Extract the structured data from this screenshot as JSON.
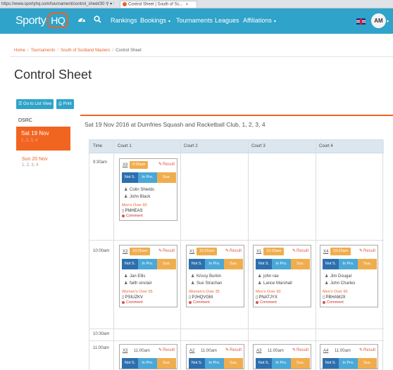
{
  "browser": {
    "url": "https://www.sportyhq.com/tournament/control_sheet/30",
    "url_icons": "⚲ ▾ ↻",
    "tab_title": "Control Sheet | South of Sc...",
    "tab_close": "×"
  },
  "navbar": {
    "logo_text": "Sporty",
    "logo_badge": "HQ",
    "items": [
      {
        "label": "Rankings"
      },
      {
        "label": "Bookings",
        "caret": "▾"
      },
      {
        "label": "Tournaments"
      },
      {
        "label": "Leagues"
      },
      {
        "label": "Affiliations",
        "caret": "▾"
      }
    ],
    "avatar_initials": "AM",
    "avatar_caret": "▾"
  },
  "breadcrumb": {
    "items": [
      "Home",
      "Tournaments",
      "South of Scotland Masters"
    ],
    "current": "Control Sheet",
    "separator": "/"
  },
  "page_title": "Control Sheet",
  "buttons": {
    "list_view": "☰ Go to List View",
    "print": "⎙ Print"
  },
  "sidebar": {
    "venue_code": "DSRC",
    "days": [
      {
        "label": "Sat 19 Nov",
        "courts": "1, 2, 3, 4"
      },
      {
        "label": "Sun 20 Nov",
        "courts": "1, 2, 3, 4"
      }
    ]
  },
  "schedule": {
    "header": "Sat 19 Nov 2016 at Dumfries Squash and Racketball Club, 1, 2, 3, 4",
    "columns": [
      "Time",
      "Court 1",
      "Court 2",
      "Court 3",
      "Court 4"
    ],
    "times": [
      "9:30am",
      "10:00am",
      "10:30am",
      "11:00am"
    ],
    "status_labels": {
      "not_started": "Not S.",
      "in_progress": "In Pro.",
      "suspended": "Sus."
    },
    "result_label": "Result",
    "comment_label": "Comment",
    "matches": [
      {
        "num": "X9",
        "time": "9:55am",
        "players": [
          "Colin Shields",
          "John Black"
        ],
        "category": "Men's Over 60",
        "code": "PMHEAS"
      },
      {
        "num": "X3",
        "time": "10:25am",
        "players": [
          "Jan Ellis",
          "faith sinclair"
        ],
        "category": "Women's Over 55",
        "code": "PSIUZKV"
      },
      {
        "num": "X1",
        "time": "10:25am",
        "players": [
          "Krissy Burkin",
          "Sue Strachan"
        ],
        "category": "Women's Over 35",
        "code": "PJHQVGM"
      },
      {
        "num": "X1",
        "time": "10:25am",
        "players": [
          "john rae",
          "Lance Marshall"
        ],
        "category": "Men's Over 60",
        "code": "PNATJYX"
      },
      {
        "num": "X4",
        "time": "10:25am",
        "players": [
          "Jim Dougal",
          "John Charles"
        ],
        "category": "Men's Over 60",
        "code": "PBHAMJX"
      },
      {
        "num": "X3",
        "time": "11:00am"
      },
      {
        "num": "A2",
        "time": "11:00am"
      },
      {
        "num": "A3",
        "time": "11:00am"
      },
      {
        "num": "A4",
        "time": "11:00am"
      }
    ]
  }
}
